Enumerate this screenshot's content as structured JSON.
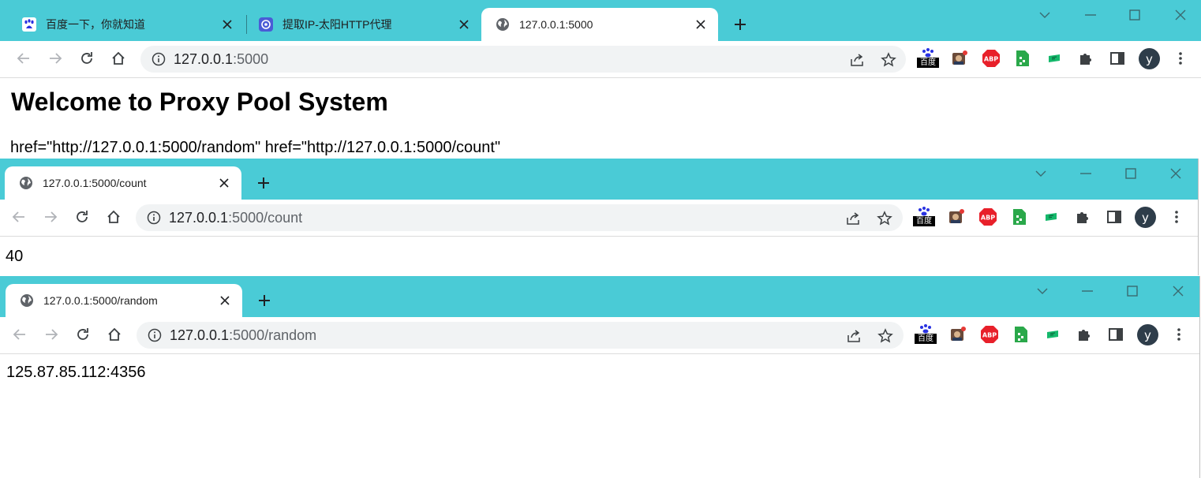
{
  "windows": [
    {
      "tabs": [
        {
          "title": "百度一下，你就知道",
          "icon": "baidu-paw-icon"
        },
        {
          "title": "提取IP-太阳HTTP代理",
          "icon": "taiyang-logo-icon"
        },
        {
          "title": "127.0.0.1:5000",
          "icon": "globe-icon"
        }
      ],
      "url_host": "127.0.0.1",
      "url_rest": ":5000",
      "page": {
        "heading": "Welcome to Proxy Pool System",
        "line": "href=\"http://127.0.0.1:5000/random\" href=\"http://127.0.0.1:5000/count\""
      }
    },
    {
      "tabs": [
        {
          "title": "127.0.0.1:5000/count",
          "icon": "globe-icon"
        }
      ],
      "url_host": "127.0.0.1",
      "url_rest": ":5000/count",
      "page": {
        "text": "40"
      }
    },
    {
      "tabs": [
        {
          "title": "127.0.0.1:5000/random",
          "icon": "globe-icon"
        }
      ],
      "url_host": "127.0.0.1",
      "url_rest": ":5000/random",
      "page": {
        "text": "125.87.85.112:4356"
      }
    }
  ],
  "extensions": {
    "baidu_label": "百度",
    "abp_label": "ABP",
    "avatar_letter": "y"
  },
  "colors": {
    "tabstrip": "#4acbd6",
    "tab_active": "#ffffff",
    "omnibox": "#f1f3f4",
    "avatar": "#2e3d4a"
  }
}
